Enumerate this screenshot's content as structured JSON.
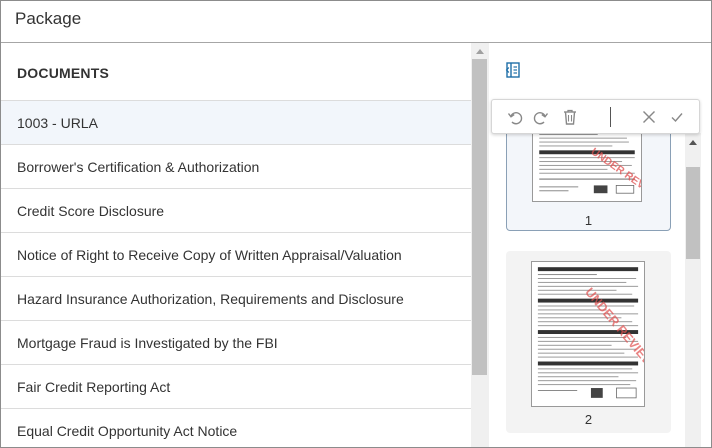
{
  "header": {
    "title": "Package"
  },
  "documents": {
    "heading": "DOCUMENTS",
    "items": [
      {
        "label": "1003 - URLA",
        "selected": true
      },
      {
        "label": "Borrower's Certification & Authorization",
        "selected": false
      },
      {
        "label": "Credit Score Disclosure",
        "selected": false
      },
      {
        "label": "Notice of Right to Receive Copy of Written Appraisal/Valuation",
        "selected": false
      },
      {
        "label": "Hazard Insurance Authorization, Requirements and Disclosure",
        "selected": false
      },
      {
        "label": "Mortgage Fraud is Investigated by the FBI",
        "selected": false
      },
      {
        "label": "Fair Credit Reporting Act",
        "selected": false
      },
      {
        "label": "Equal Credit Opportunity Act Notice",
        "selected": false
      }
    ]
  },
  "toolbar": {
    "icons": [
      "undo-icon",
      "redo-icon",
      "trash-icon",
      "close-icon",
      "check-icon"
    ]
  },
  "thumbnails": {
    "pages": [
      {
        "number": "1",
        "stamp": "UNDER REVIEW"
      },
      {
        "number": "2",
        "stamp": "UNDER REVIEW"
      }
    ]
  },
  "colors": {
    "accent": "#1f6fa8",
    "stamp": "#e0504f",
    "selected_row": "#f2f6fb"
  }
}
